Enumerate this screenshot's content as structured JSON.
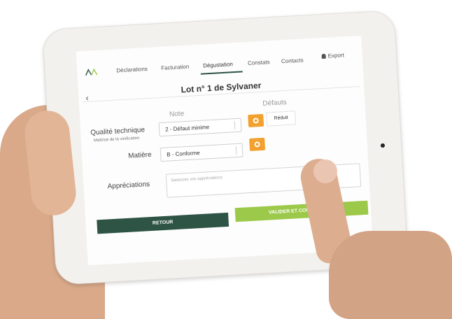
{
  "nav": {
    "tabs": [
      {
        "label": "Déclarations"
      },
      {
        "label": "Facturation"
      },
      {
        "label": "Dégustation"
      },
      {
        "label": "Constats"
      },
      {
        "label": "Contacts"
      }
    ],
    "active_tab": "Dégustation",
    "export_label": "Export"
  },
  "page": {
    "back_glyph": "‹",
    "title": "Lot n° 1 de Sylvaner"
  },
  "columns": {
    "note": "Note",
    "defauts": "Défauts"
  },
  "rows": [
    {
      "label": "Qualité technique",
      "sublabel": "Maîtrise de la vinification",
      "value": "2 - Défaut minime",
      "defect_chip": "Réduit"
    },
    {
      "label": "Matière",
      "value": "B - Conforme"
    }
  ],
  "appreciations": {
    "label": "Appréciations",
    "placeholder": "Saisissez vos appréciations"
  },
  "buttons": {
    "retour": "RETOUR",
    "valider": "VALIDER ET CONT"
  },
  "colors": {
    "primary_dark_green": "#2e5446",
    "accent_green": "#9cc94a",
    "orange": "#f2a12e"
  }
}
